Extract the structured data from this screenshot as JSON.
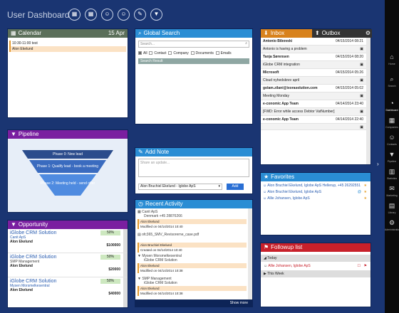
{
  "header": {
    "title": "User Dashboard",
    "buttons": [
      "building-icon",
      "building-add-icon",
      "person-icon",
      "person-add-icon",
      "edit-icon",
      "filter-icon"
    ]
  },
  "calendar": {
    "title": "Calendar",
    "date": "15 Apr",
    "event_time": "10:30-11:00 test",
    "event_person": "Alon Ekelund"
  },
  "search": {
    "title": "Global Search",
    "placeholder": "Search...",
    "filters": [
      "All",
      "Contact",
      "Company",
      "Documents",
      "Emails"
    ],
    "result_label": "Search Result"
  },
  "inbox": {
    "tab_inbox": "Inbox",
    "tab_outbox": "Outbox",
    "items": [
      {
        "from": "Antonio Bibovski",
        "date": "04/15/2014 08:21",
        "subject": "Antonio is having a problem"
      },
      {
        "from": "Tanja Sørensen",
        "date": "04/15/2014 08:20",
        "subject": "iGlobe CRM integration"
      },
      {
        "from": "Microsoft",
        "date": "04/15/2014 05:26",
        "subject": "Cloud nyhedsbrev april"
      },
      {
        "from": "golam.zilani@ixorasolution.com",
        "date": "04/15/2014 05:02",
        "subject": "Meeting Monday"
      },
      {
        "from": "e-conomic App Team",
        "date": "04/14/2014 23:40",
        "subject": "[FWD: Error while access Debtor VatNumber]"
      },
      {
        "from": "e-conomic App Team",
        "date": "04/14/2014 22:40",
        "subject": ""
      }
    ]
  },
  "pipeline": {
    "title": "Pipeline",
    "stages": [
      "Phase 0: New lead",
      "Phase 1: Qualify lead - book a meeting",
      "Phase 2: Meeting held - send offer"
    ]
  },
  "note": {
    "title": "Add Note",
    "placeholder": "Share an update...",
    "select": "Alon Bruchiel Ekelund - Iglobe ApS",
    "add": "Add"
  },
  "favorites": {
    "title": "Favorites",
    "items": [
      "Alon Bruchiel Ekelund, Iglobe ApS Hellerup, +45 26292551",
      "Alon Bruchiel Ekelund, Iglobe ApS",
      "Allie Johansen, Iglobe ApS"
    ]
  },
  "opportunity": {
    "title": "Opportunity",
    "items": [
      {
        "name": "iGlobe CRM Solution",
        "company": "Canit ApS",
        "person": "Alon Ekelund",
        "pct": "50%",
        "amount": "$100000"
      },
      {
        "name": "iGlobe CRM Solution",
        "company": "SMP Management",
        "person": "Alon Ekelund",
        "pct": "50%",
        "amount": "$20000"
      },
      {
        "name": "iGlobe CRM Solution",
        "company": "Mysen Morsmelkesentral",
        "person": "Alon Ekelund",
        "pct": "50%",
        "amount": "$40000"
      }
    ]
  },
  "activity": {
    "title": "Recent Activity",
    "show_more": "Show more",
    "items": [
      {
        "name": "Canit ApS",
        "sub": "Denmark +45 28876266",
        "user": "Alon Ekelund",
        "when": "Modified on 04/14/2014 10:40"
      },
      {
        "name": "ofc365_SMV_Revisorerne_case.pdf",
        "sub": "",
        "user": "Alon Bruchiel Ekelund",
        "when": "Created on 04/14/2014 10:40"
      },
      {
        "name": "Mysen Morsmelkesentral",
        "sub": "iGlobe CRM Solution",
        "user": "Alon Ekelund",
        "when": "Modified on 04/14/2014 10:38"
      },
      {
        "name": "SMP Management",
        "sub": "iGlobe CRM Solution",
        "user": "Alon Ekelund",
        "when": "Modified on 04/14/2014 10:38"
      }
    ]
  },
  "followup": {
    "title": "Followup list",
    "today": "Today",
    "item": "Allie Johansen, Iglobe ApS",
    "this_week": "This Week"
  },
  "rail": {
    "items": [
      "Home",
      "Search",
      "Dashboard",
      "Companies",
      "Contacts",
      "Pipeline",
      "Statistics",
      "Marketing",
      "Library",
      "Administration"
    ]
  }
}
